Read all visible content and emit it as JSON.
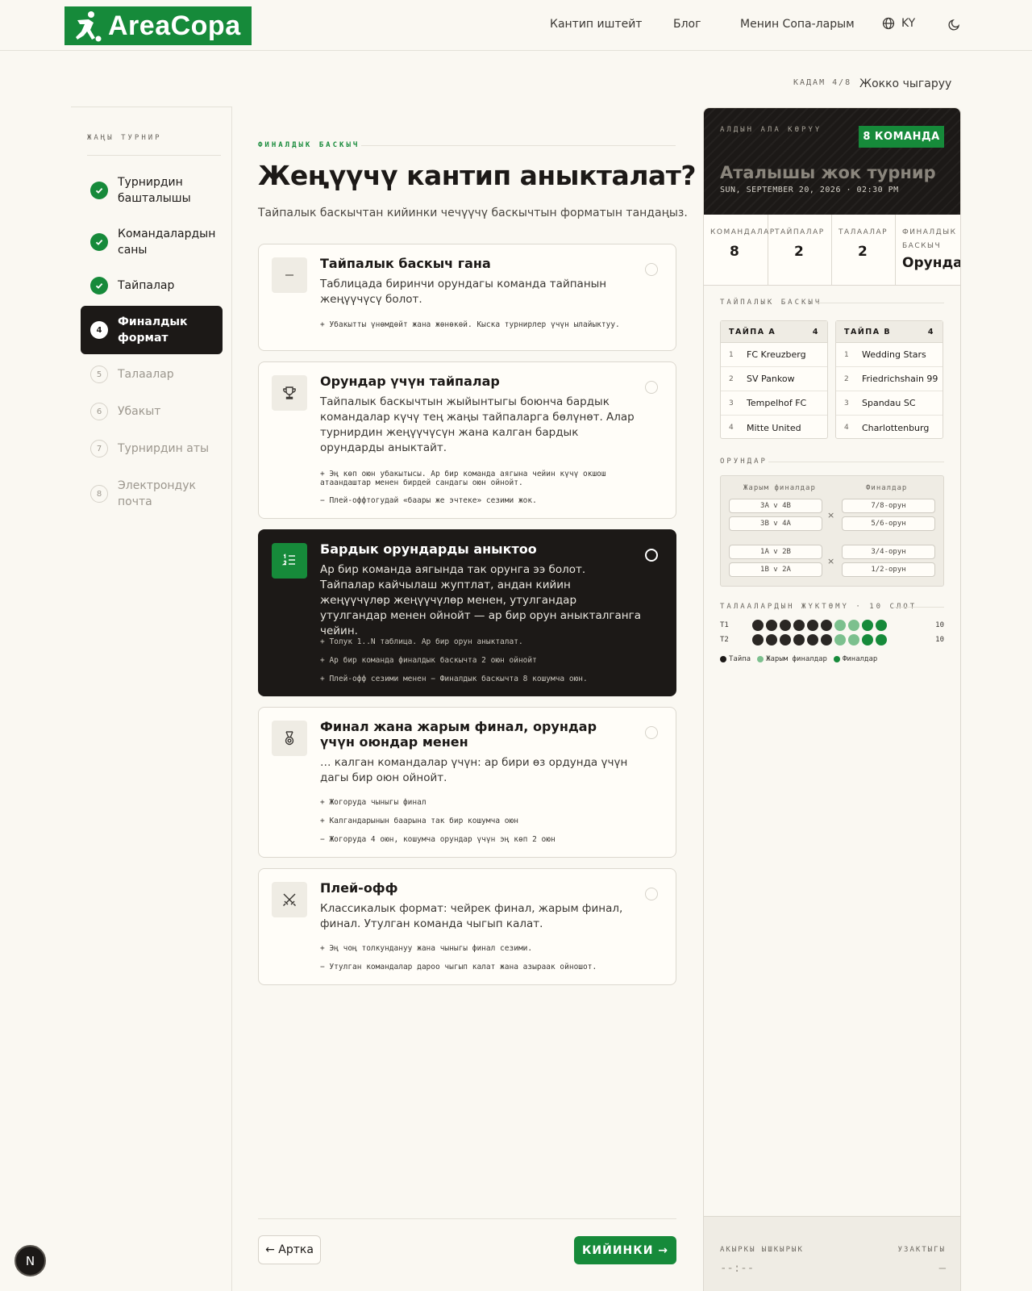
{
  "brand": {
    "name": "AreaCopa",
    "accent": "#168a3a",
    "dark": "#1c1917"
  },
  "nav": {
    "items": [
      "Кантип иштейт",
      "Блог",
      "Менин Сопа-ларым"
    ],
    "lang": "KY",
    "lang_icon": "globe-icon",
    "theme_icon": "moon-icon"
  },
  "wizard": {
    "step_label": "КАДАМ 4/8",
    "cancel": "Жокко чыгаруу"
  },
  "sidebar": {
    "title": "ЖАҢЫ ТУРНИР",
    "items": [
      {
        "num": "1",
        "label": "Турнирдин башталышы",
        "state": "done"
      },
      {
        "num": "2",
        "label": "Командалардын саны",
        "state": "done"
      },
      {
        "num": "3",
        "label": "Тайпалар",
        "state": "done"
      },
      {
        "num": "4",
        "label": "Финалдык формат",
        "state": "current"
      },
      {
        "num": "5",
        "label": "Талаалар",
        "state": "pending"
      },
      {
        "num": "6",
        "label": "Убакыт",
        "state": "pending"
      },
      {
        "num": "7",
        "label": "Турнирдин аты",
        "state": "pending"
      },
      {
        "num": "8",
        "label": "Электрондук почта",
        "state": "pending"
      }
    ]
  },
  "main": {
    "eyebrow": "ФИНАЛДЫК БАСКЫЧ",
    "title": "Жеңүүчү кантип аныкталат?",
    "subtitle": "Тайпалык баскычтан кийинки чечүүчү баскычтын форматын тандаңыз.",
    "options": [
      {
        "icon": "dash-icon",
        "title": "Тайпалык баскыч гана",
        "desc": "Таблицада биринчи орундагы команда тайпанын жеңүүчүсү болот.",
        "bullets": [
          "+ Убакытты үнөмдөйт жана жөнөкөй. Кыска турнирлер үчүн ылайыктуу."
        ],
        "selected": false
      },
      {
        "icon": "trophy-icon",
        "title": "Орундар үчүн тайпалар",
        "desc": "Тайпалык баскычтын жыйынтыгы боюнча бардык командалар күчү тең жаңы тайпаларга бөлүнөт. Алар турнирдин жеңүүчүсүн жана калган бардык орундарды аныктайт.",
        "bullets": [
          "+ Эң көп оюн убакытысы. Ар бир команда аягына чейин күчү окшош атаандаштар менен бирдей сандагы оюн ойнойт.",
          "− Плей-оффтогудай «баары же эчтеке» сезими жок."
        ],
        "selected": false
      },
      {
        "icon": "ranked-list-icon",
        "title": "Бардык орундарды аныктоо",
        "desc": "Ар бир команда аягында так орунга ээ болот. Тайпалар кайчылаш жуптлат, андан кийин жеңүүчүлөр жеңүүчүлөр менен, утулгандар утулгандар менен ойнойт — ар бир орун аныкталганга чейин.",
        "bullets": [
          "+ Толук 1..N таблица. Ар бир орун аныкталат.",
          "+ Ар бир команда финалдык баскычта 2 оюн ойнойт",
          "+ Плей-офф сезими менен  − Финалдык баскычта 8 кошумча оюн."
        ],
        "selected": true
      },
      {
        "icon": "medal-icon",
        "title": "Финал жана жарым финал, орундар үчүн оюндар менен",
        "desc": "… калган командалар үчүн: ар бири өз ордунда үчүн дагы бир оюн ойнойт.",
        "bullets": [
          "+ Жогоруда чыныгы финал",
          "+ Калгандарынын баарына так бир кошумча оюн",
          "− Жогоруда 4 оюн, кошумча орундар үчүн эң көп 2 оюн"
        ],
        "selected": false
      },
      {
        "icon": "crossed-swords-icon",
        "title": "Плей-офф",
        "desc": "Классикалык формат: чейрек финал, жарым финал, финал. Утулган команда чыгып калат.",
        "bullets": [
          "+ Эң чоң толкундануу жана чыныгы финал сезими.",
          "− Утулган командалар дароо чыгып калат жана азыраак ойношот."
        ],
        "selected": false
      }
    ],
    "back": "← Артка",
    "next": "КИЙИНКИ →"
  },
  "preview": {
    "eyebrow": "АЛДЫН АЛА КӨРҮҮ",
    "badge": "8 КОМАНДА",
    "name": "Аталышы жок турнир",
    "date": "SUN, SEPTEMBER 20, 2026 · 02:30 PM",
    "stats": [
      {
        "label": "КОМАНДАЛАР",
        "value": "8"
      },
      {
        "label": "ТАЙПАЛАР",
        "value": "2"
      },
      {
        "label": "ТАЛААЛАР",
        "value": "2"
      },
      {
        "label": "ФИНАЛДЫК БАСКЫЧ",
        "value": "Орундар"
      }
    ],
    "groups_label": "ТАЙПАЛЫК БАСКЫЧ",
    "groups": [
      {
        "name": "ТАЙПА А",
        "count": "4",
        "teams": [
          "FC Kreuzberg",
          "SV Pankow",
          "Tempelhof FC",
          "Mitte United"
        ]
      },
      {
        "name": "ТАЙПА В",
        "count": "4",
        "teams": [
          "Wedding Stars",
          "Friedrichshain 99",
          "Spandau SC",
          "Charlottenburg"
        ]
      }
    ],
    "placements_label": "ОРУНДАР",
    "bracket": {
      "semi_label": "Жарым финалдар",
      "final_label": "Финалдар",
      "semis": [
        "3A v 4B",
        "3B v 4A",
        "1A v 2B",
        "1B v 2A"
      ],
      "finals": [
        "7/8-орун",
        "5/6-орун",
        "3/4-орун",
        "1/2-орун"
      ],
      "vs": "×"
    },
    "load_label": "ТАЛААЛАРДЫН ЖҮКТӨМҮ · 10 СЛОТ",
    "load": [
      {
        "field": "T1",
        "slots": [
          "group",
          "group",
          "group",
          "group",
          "group",
          "group",
          "semi",
          "semi",
          "final",
          "final"
        ],
        "count": "10"
      },
      {
        "field": "T2",
        "slots": [
          "group",
          "group",
          "group",
          "group",
          "group",
          "group",
          "semi",
          "semi",
          "final",
          "final"
        ],
        "count": "10"
      }
    ],
    "slot_colors": {
      "group": "#2a2724",
      "semi": "#7cc08e",
      "final": "#168a3a"
    },
    "legend": [
      "Тайпа",
      "Жарым финалдар",
      "Финалдар"
    ],
    "footer": {
      "last_label": "АКЫРКЫ ЫШКЫРЫК",
      "last_value": "--:--",
      "dur_label": "УЗАКТЫГЫ",
      "dur_value": "—"
    }
  },
  "devbadge": "N"
}
